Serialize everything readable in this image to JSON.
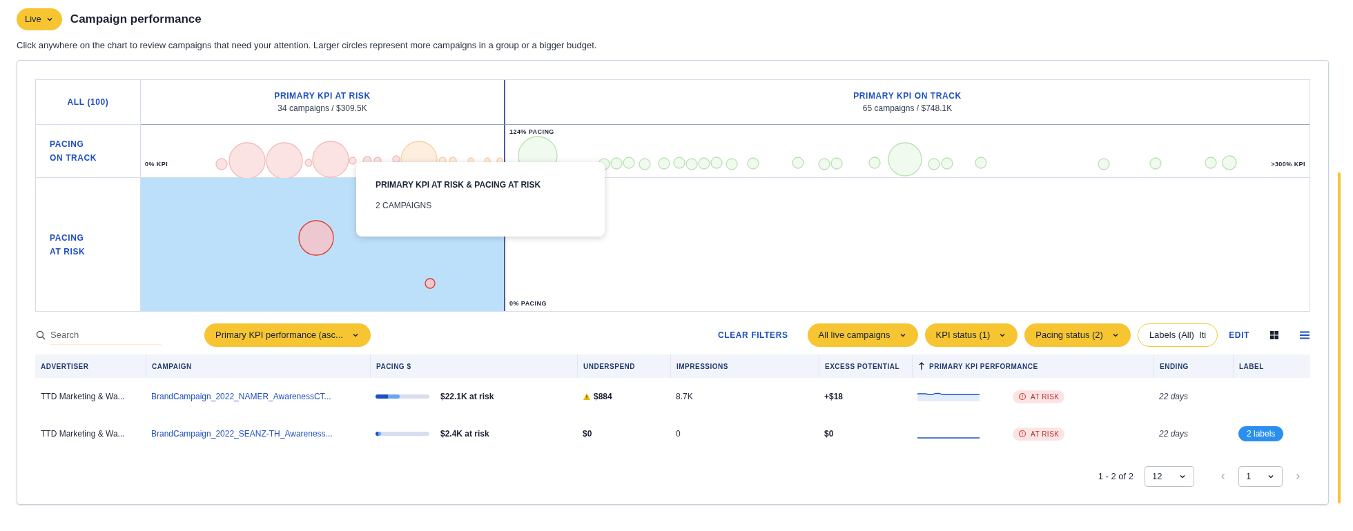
{
  "header": {
    "status": "Live",
    "title": "Campaign performance",
    "description": "Click anywhere on the chart to review campaigns that need your attention. Larger circles represent more campaigns in a group or a bigger budget."
  },
  "chart": {
    "corner_label": "ALL (100)",
    "columns": [
      {
        "title": "PRIMARY KPI AT RISK",
        "subtitle": "34 campaigns / $309.5K"
      },
      {
        "title": "PRIMARY KPI ON TRACK",
        "subtitle": "65 campaigns / $748.1K"
      }
    ],
    "rows": [
      {
        "label": "PACING\nON TRACK",
        "cells": [
          {
            "selected": false
          },
          {
            "selected": false
          }
        ]
      },
      {
        "label": "PACING\nAT RISK",
        "cells": [
          {
            "selected": true
          },
          {
            "selected": false
          }
        ]
      }
    ],
    "axis_labels": {
      "kpi_min": "0% KPI",
      "kpi_max": ">300% KPI",
      "pacing_max": "124% PACING",
      "pacing_min": "0% PACING"
    },
    "tooltip": {
      "title": "PRIMARY KPI AT RISK & PACING AT RISK",
      "subtitle": "2 CAMPAIGNS"
    }
  },
  "toolbar": {
    "search_placeholder": "Search",
    "sort": "Primary KPI performance (asc...",
    "clear": "CLEAR FILTERS",
    "filters": [
      {
        "label": "All live campaigns",
        "active": true
      },
      {
        "label": "KPI status (1)",
        "active": true
      },
      {
        "label": "Pacing status (2)",
        "active": true
      },
      {
        "label": "Labels (All)  Iti",
        "active": false
      }
    ],
    "edit": "EDIT",
    "views": [
      {
        "kind": "grid",
        "selected": false
      },
      {
        "kind": "list",
        "selected": true
      }
    ]
  },
  "table": {
    "columns": [
      {
        "label": "ADVERTISER",
        "sorted": false
      },
      {
        "label": "CAMPAIGN",
        "sorted": false
      },
      {
        "label": "PACING $",
        "sorted": false
      },
      {
        "label": "UNDERSPEND",
        "sorted": false
      },
      {
        "label": "IMPRESSIONS",
        "sorted": false
      },
      {
        "label": "EXCESS POTENTIAL",
        "sorted": false
      },
      {
        "label": "PRIMARY KPI PERFORMANCE",
        "sorted": true
      },
      {
        "label": "ENDING",
        "sorted": false
      },
      {
        "label": "LABEL",
        "sorted": false
      }
    ],
    "rows": [
      {
        "advertiser": "TTD Marketing & Wa...",
        "campaign": "BrandCampaign_2022_NAMER_AwarenessCT...",
        "pacing": {
          "level": 0.45,
          "text": "$22.1K at risk"
        },
        "underspend": {
          "text": "$884",
          "warning": true
        },
        "impressions": "8.7K",
        "excess": "+$18",
        "kpi_status": "AT RISK",
        "ending": "22 days"
      },
      {
        "advertiser": "TTD Marketing & Wa...",
        "campaign": "BrandCampaign_2022_SEANZ-TH_Awareness...",
        "pacing": {
          "level": 0.1,
          "text": "$2.4K at risk"
        },
        "underspend": {
          "text": "$0",
          "warning": false
        },
        "impressions": "0",
        "excess": "$0",
        "kpi_status": "AT RISK",
        "ending": "22 days",
        "label": "2 labels"
      }
    ]
  },
  "pagination": {
    "range": "1 - 2 of 2",
    "page_size": "12",
    "page": "1"
  }
}
